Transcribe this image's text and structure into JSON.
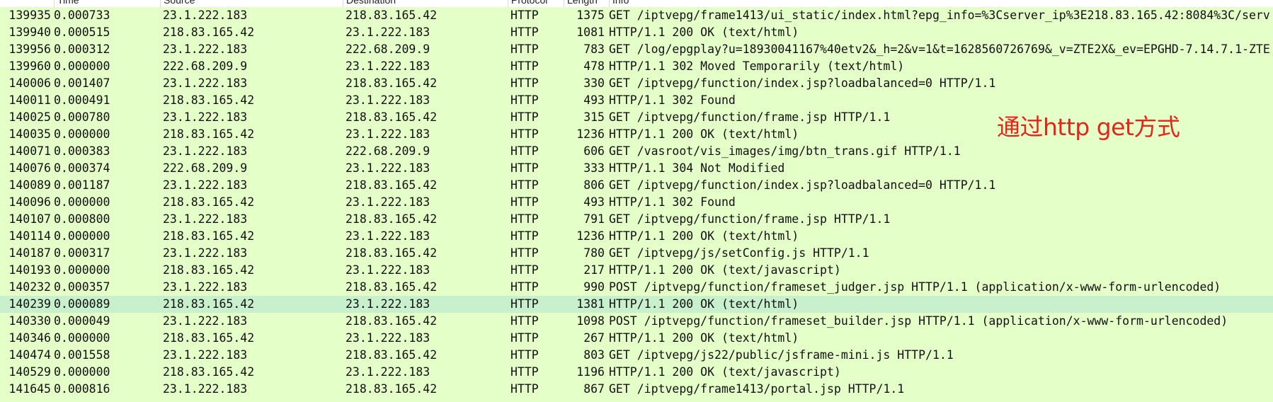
{
  "columns": {
    "time": "Time",
    "source": "Source",
    "destination": "Destination",
    "protocol": "Protocol",
    "length": "Length",
    "info": "Info"
  },
  "annotation": "通过http get方式",
  "selected_row": "140239",
  "packets": [
    {
      "no": "139935",
      "time": "0.000733",
      "source": "23.1.222.183",
      "destination": "218.83.165.42",
      "protocol": "HTTP",
      "length": "1375",
      "info": "GET /iptvepg/frame1413/ui_static/index.html?epg_info=%3Cserver_ip%3E218.83.165.42:8084%3C/serv"
    },
    {
      "no": "139940",
      "time": "0.000515",
      "source": "218.83.165.42",
      "destination": "23.1.222.183",
      "protocol": "HTTP",
      "length": "1081",
      "info": "HTTP/1.1 200 OK  (text/html)"
    },
    {
      "no": "139956",
      "time": "0.000312",
      "source": "23.1.222.183",
      "destination": "222.68.209.9",
      "protocol": "HTTP",
      "length": "783",
      "info": "GET /log/epgplay?u=18930041167%40etv2&_h=2&v=1&t=1628560726769&_v=ZTE2X&_ev=EPGHD-7.14.7.1-ZTE"
    },
    {
      "no": "139960",
      "time": "0.000000",
      "source": "222.68.209.9",
      "destination": "23.1.222.183",
      "protocol": "HTTP",
      "length": "478",
      "info": "HTTP/1.1 302 Moved Temporarily  (text/html)"
    },
    {
      "no": "140006",
      "time": "0.001407",
      "source": "23.1.222.183",
      "destination": "218.83.165.42",
      "protocol": "HTTP",
      "length": "330",
      "info": "GET /iptvepg/function/index.jsp?loadbalanced=0 HTTP/1.1"
    },
    {
      "no": "140011",
      "time": "0.000491",
      "source": "218.83.165.42",
      "destination": "23.1.222.183",
      "protocol": "HTTP",
      "length": "493",
      "info": "HTTP/1.1 302 Found"
    },
    {
      "no": "140025",
      "time": "0.000780",
      "source": "23.1.222.183",
      "destination": "218.83.165.42",
      "protocol": "HTTP",
      "length": "315",
      "info": "GET /iptvepg/function/frame.jsp HTTP/1.1"
    },
    {
      "no": "140035",
      "time": "0.000000",
      "source": "218.83.165.42",
      "destination": "23.1.222.183",
      "protocol": "HTTP",
      "length": "1236",
      "info": "HTTP/1.1 200 OK  (text/html)"
    },
    {
      "no": "140071",
      "time": "0.000383",
      "source": "23.1.222.183",
      "destination": "222.68.209.9",
      "protocol": "HTTP",
      "length": "606",
      "info": "GET /vasroot/vis_images/img/btn_trans.gif HTTP/1.1"
    },
    {
      "no": "140076",
      "time": "0.000374",
      "source": "222.68.209.9",
      "destination": "23.1.222.183",
      "protocol": "HTTP",
      "length": "333",
      "info": "HTTP/1.1 304 Not Modified"
    },
    {
      "no": "140089",
      "time": "0.001187",
      "source": "23.1.222.183",
      "destination": "218.83.165.42",
      "protocol": "HTTP",
      "length": "806",
      "info": "GET /iptvepg/function/index.jsp?loadbalanced=0 HTTP/1.1"
    },
    {
      "no": "140096",
      "time": "0.000000",
      "source": "218.83.165.42",
      "destination": "23.1.222.183",
      "protocol": "HTTP",
      "length": "493",
      "info": "HTTP/1.1 302 Found"
    },
    {
      "no": "140107",
      "time": "0.000800",
      "source": "23.1.222.183",
      "destination": "218.83.165.42",
      "protocol": "HTTP",
      "length": "791",
      "info": "GET /iptvepg/function/frame.jsp HTTP/1.1"
    },
    {
      "no": "140114",
      "time": "0.000000",
      "source": "218.83.165.42",
      "destination": "23.1.222.183",
      "protocol": "HTTP",
      "length": "1236",
      "info": "HTTP/1.1 200 OK  (text/html)"
    },
    {
      "no": "140187",
      "time": "0.000317",
      "source": "23.1.222.183",
      "destination": "218.83.165.42",
      "protocol": "HTTP",
      "length": "780",
      "info": "GET /iptvepg/js/setConfig.js HTTP/1.1"
    },
    {
      "no": "140193",
      "time": "0.000000",
      "source": "218.83.165.42",
      "destination": "23.1.222.183",
      "protocol": "HTTP",
      "length": "217",
      "info": "HTTP/1.1 200 OK  (text/javascript)"
    },
    {
      "no": "140232",
      "time": "0.000357",
      "source": "23.1.222.183",
      "destination": "218.83.165.42",
      "protocol": "HTTP",
      "length": "990",
      "info": "POST /iptvepg/function/frameset_judger.jsp HTTP/1.1  (application/x-www-form-urlencoded)"
    },
    {
      "no": "140239",
      "time": "0.000089",
      "source": "218.83.165.42",
      "destination": "23.1.222.183",
      "protocol": "HTTP",
      "length": "1381",
      "info": "HTTP/1.1 200 OK  (text/html)"
    },
    {
      "no": "140330",
      "time": "0.000049",
      "source": "23.1.222.183",
      "destination": "218.83.165.42",
      "protocol": "HTTP",
      "length": "1098",
      "info": "POST /iptvepg/function/frameset_builder.jsp HTTP/1.1  (application/x-www-form-urlencoded)"
    },
    {
      "no": "140346",
      "time": "0.000000",
      "source": "218.83.165.42",
      "destination": "23.1.222.183",
      "protocol": "HTTP",
      "length": "267",
      "info": "HTTP/1.1 200 OK  (text/html)"
    },
    {
      "no": "140474",
      "time": "0.001558",
      "source": "23.1.222.183",
      "destination": "218.83.165.42",
      "protocol": "HTTP",
      "length": "803",
      "info": "GET /iptvepg/js22/public/jsframe-mini.js HTTP/1.1"
    },
    {
      "no": "140529",
      "time": "0.000000",
      "source": "218.83.165.42",
      "destination": "23.1.222.183",
      "protocol": "HTTP",
      "length": "1196",
      "info": "HTTP/1.1 200 OK  (text/javascript)"
    },
    {
      "no": "141645",
      "time": "0.000816",
      "source": "23.1.222.183",
      "destination": "218.83.165.42",
      "protocol": "HTTP",
      "length": "867",
      "info": "GET /iptvepg/frame1413/portal.jsp HTTP/1.1"
    }
  ]
}
